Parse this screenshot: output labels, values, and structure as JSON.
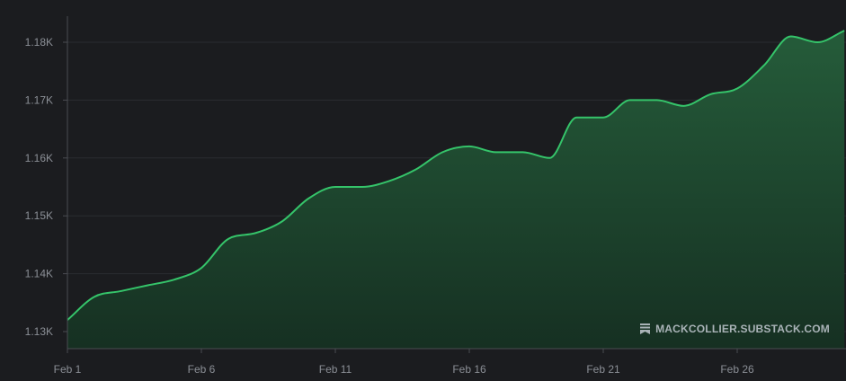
{
  "chart_data": {
    "type": "area",
    "x": [
      "Feb 1",
      "Feb 2",
      "Feb 3",
      "Feb 4",
      "Feb 5",
      "Feb 6",
      "Feb 7",
      "Feb 8",
      "Feb 9",
      "Feb 10",
      "Feb 11",
      "Feb 12",
      "Feb 13",
      "Feb 14",
      "Feb 15",
      "Feb 16",
      "Feb 17",
      "Feb 18",
      "Feb 19",
      "Feb 20",
      "Feb 21",
      "Feb 22",
      "Feb 23",
      "Feb 24",
      "Feb 25",
      "Feb 26",
      "Feb 27",
      "Feb 28",
      "Feb 29",
      "Mar 1"
    ],
    "values": [
      1132,
      1136,
      1137,
      1138,
      1139,
      1141,
      1146,
      1147,
      1149,
      1153,
      1155,
      1155,
      1156,
      1158,
      1161,
      1162,
      1161,
      1161,
      1160,
      1167,
      1167,
      1170,
      1170,
      1169,
      1171,
      1172,
      1176,
      1181,
      1180,
      1182
    ],
    "x_ticks": [
      "Feb 1",
      "Feb 6",
      "Feb 11",
      "Feb 16",
      "Feb 21",
      "Feb 26"
    ],
    "y_ticks": [
      "1.13K",
      "1.14K",
      "1.15K",
      "1.16K",
      "1.17K",
      "1.18K"
    ],
    "ylim": [
      1130,
      1180
    ],
    "grid": true,
    "colors": {
      "line": "#35c46a",
      "area_top": "#255c3a",
      "area_bottom": "#163022",
      "background": "#1b1c1f",
      "grid": "#2a2c30",
      "axis": "#4a4c52",
      "tick_text": "#8b8f96"
    }
  },
  "watermark": {
    "text": "MACKCOLLIER.SUBSTACK.COM",
    "icon": "substack-logo-icon"
  }
}
